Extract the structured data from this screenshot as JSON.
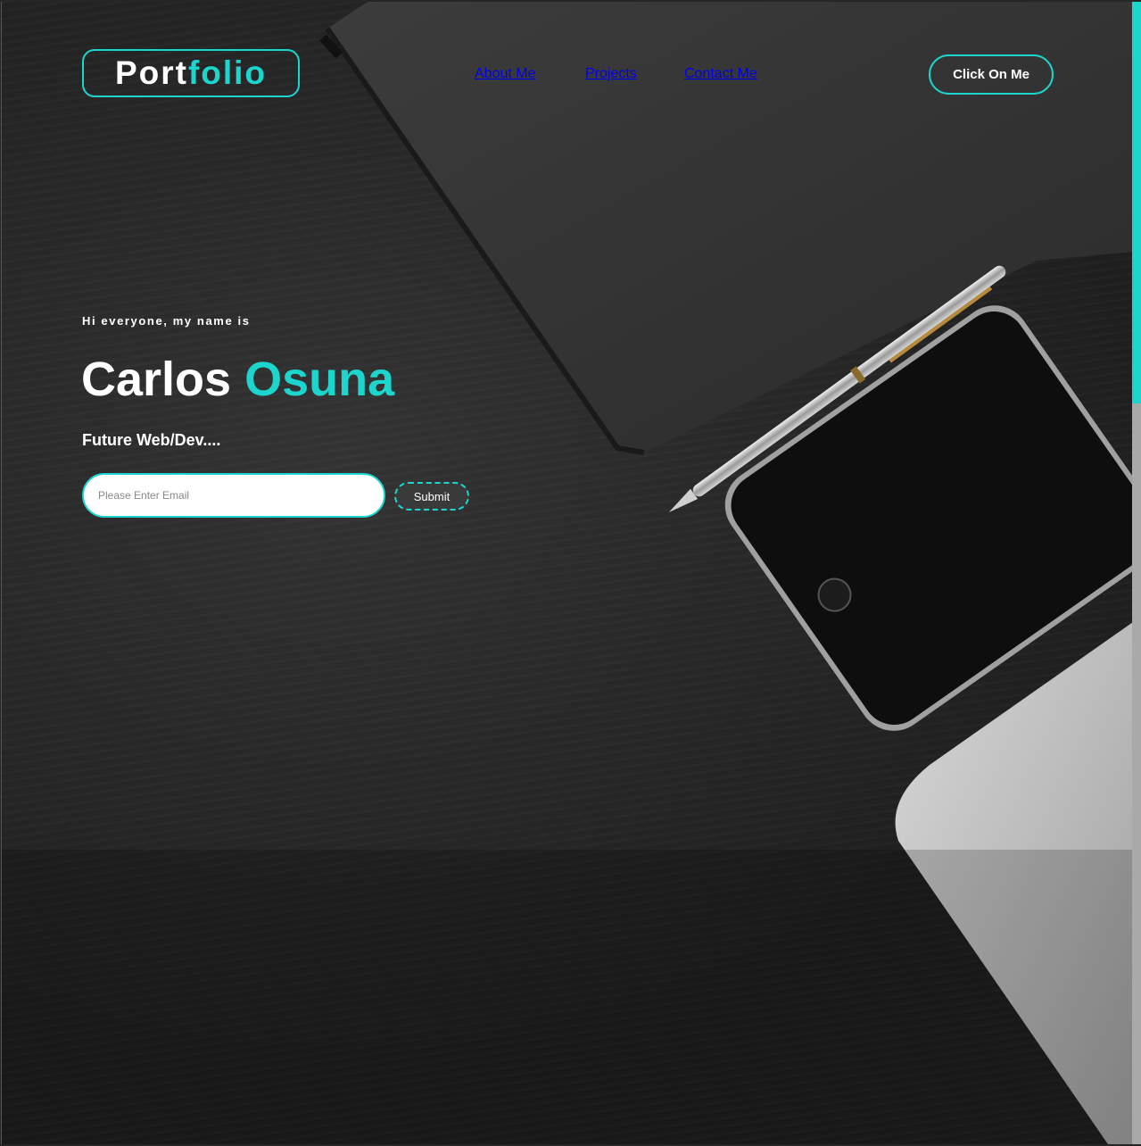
{
  "colors": {
    "accent": "#1cd6ce",
    "background": "#2a2a2a",
    "text": "#ffffff"
  },
  "header": {
    "logo": {
      "part1": "Port",
      "part2": "folio"
    },
    "nav": [
      {
        "label": "About Me"
      },
      {
        "label": "Projects"
      },
      {
        "label": "Contact Me"
      }
    ],
    "cta_label": "Click On Me"
  },
  "hero": {
    "greeting": "Hi everyone, my name is",
    "first_name": "Carlos",
    "last_name": "Osuna",
    "subtitle": "Future Web/Dev....",
    "email_placeholder": "Please Enter Email",
    "submit_label": "Submit"
  }
}
